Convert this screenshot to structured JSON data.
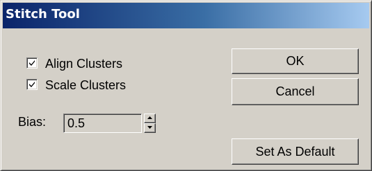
{
  "window": {
    "title": "Stitch Tool"
  },
  "options": {
    "align_clusters": {
      "label": "Align Clusters",
      "checked": true
    },
    "scale_clusters": {
      "label": "Scale Clusters",
      "checked": true
    }
  },
  "bias": {
    "label": "Bias:",
    "value": "0.5"
  },
  "buttons": {
    "ok": "OK",
    "cancel": "Cancel",
    "set_as_default": "Set As Default"
  },
  "colors": {
    "title_gradient_start": "#0a246a",
    "title_gradient_end": "#a6caf0",
    "face": "#d4d0c8"
  }
}
